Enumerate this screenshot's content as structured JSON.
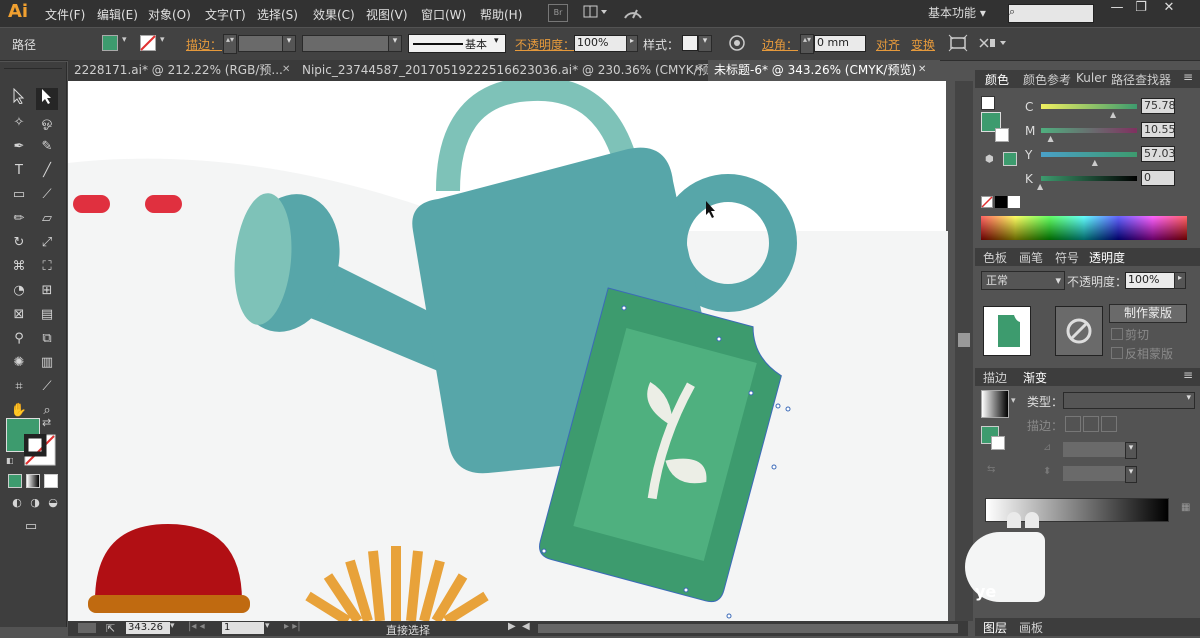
{
  "menubar": {
    "logo": "Ai",
    "menus": [
      "文件(F)",
      "编辑(E)",
      "对象(O)",
      "文字(T)",
      "选择(S)",
      "效果(C)",
      "视图(V)",
      "窗口(W)",
      "帮助(H)"
    ],
    "bridge": "Br",
    "workspace": "基本功能"
  },
  "control_bar": {
    "selection_label": "路径",
    "stroke_label": "描边：",
    "stroke_style": "基本",
    "opacity_label": "不透明度：",
    "opacity_value": "100%",
    "style_label": "样式：",
    "corner_label": "边角：",
    "corner_value": "0 mm",
    "align_label": "对齐",
    "transform_label": "变换",
    "fill_color": "#3d9b6e"
  },
  "doc_tabs": [
    {
      "label": "2228171.ai* @ 212.22% (RGB/预..."
    },
    {
      "label": "Nipic_23744587_20170519222516623036.ai* @ 230.36% (CMYK/预..."
    },
    {
      "label": "未标题-6* @ 343.26% (CMYK/预览)"
    }
  ],
  "status_bar": {
    "zoom": "343.26",
    "page": "1",
    "tool_name": "直接选择"
  },
  "color_panel": {
    "tabs": [
      "颜色",
      "颜色参考",
      "Kuler",
      "路径查找器"
    ],
    "channels": [
      {
        "name": "C",
        "value": "75.78"
      },
      {
        "name": "M",
        "value": "10.55"
      },
      {
        "name": "Y",
        "value": "57.03"
      },
      {
        "name": "K",
        "value": "0"
      }
    ],
    "channel_fractions": [
      0.76,
      0.11,
      0.57,
      0.0
    ]
  },
  "transparency_panel": {
    "tabs": [
      "色板",
      "画笔",
      "符号",
      "透明度"
    ],
    "blend_mode": "正常",
    "opacity_label": "不透明度：",
    "opacity_value": "100%",
    "make_mask_button": "制作蒙版",
    "clip_label": "剪切",
    "invert_label": "反相蒙版"
  },
  "gradient_panel": {
    "tabs": [
      "描边",
      "渐变"
    ],
    "type_label": "类型：",
    "stroke_label": "描边："
  },
  "bottom_panel": {
    "tabs": [
      "图层",
      "画板"
    ]
  },
  "colors": {
    "can_body": "#57a6a9",
    "can_light": "#7ec2b8",
    "tag_green": "#3d9b6e",
    "tag_inner": "#4fb07f",
    "accent_red": "#e0303f",
    "dome_red": "#b10f14",
    "dome_band": "#c06a10",
    "sun_orange": "#e8a23a"
  }
}
